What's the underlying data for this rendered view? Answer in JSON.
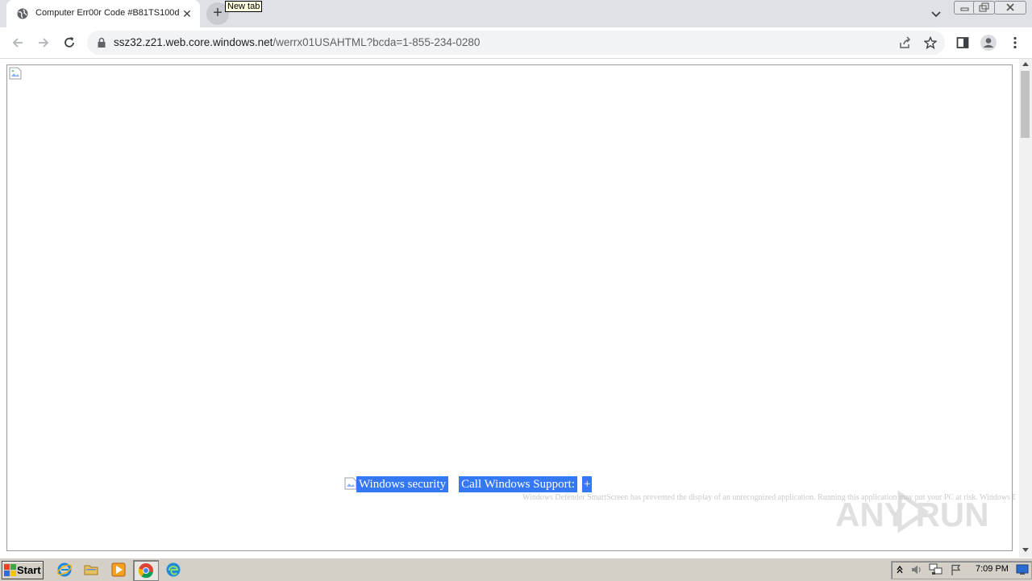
{
  "browser": {
    "tab": {
      "title": "Computer Err00r Code #B81TS100d",
      "close_glyph": "✕",
      "favicon": "globe-icon"
    },
    "new_tab_tooltip": "New tab",
    "new_tab_glyph": "+",
    "address": {
      "host": "ssz32.z21.web.core.windows.net",
      "path": "/werrx01USAHTML?bcda=1-855-234-0280"
    }
  },
  "page": {
    "security_label": "Windows security",
    "support_label": "Call Windows Support:",
    "plus_glyph": "+",
    "smartscreen_text": "Windows Defender SmartScreen has prevented the display of an unrecognized application. Running this application may put your PC at risk. Windows Defe",
    "watermark": "ANY RUN"
  },
  "taskbar": {
    "start_label": "Start",
    "clock": "7:09 PM"
  },
  "colors": {
    "selection": "#3478f6",
    "tabstrip": "#dee1e6",
    "taskbar": "#d4d0c8"
  }
}
